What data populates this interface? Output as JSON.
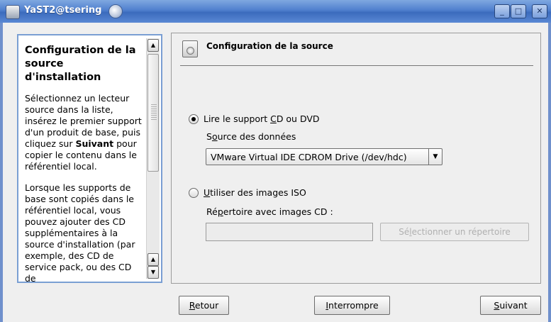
{
  "window": {
    "title": "YaST2@tsering",
    "controls": {
      "minimize": "minimize-icon",
      "maximize": "maximize-icon",
      "close": "close-icon"
    }
  },
  "help": {
    "title": "Configuration de la source d'installation",
    "paragraph1_before": "Sélectionnez un lecteur source dans la liste, insérez le premier support d'un produit de base, puis cliquez sur",
    "paragraph1_bold": "Suivant",
    "paragraph1_after": "pour copier le contenu dans le référentiel local.",
    "paragraph2": "Lorsque les supports de base sont copiés dans le référentiel local, vous pouvez ajouter des CD supplémentaires à la source d'installation (par exemple, des CD de service pack, ou des CD de"
  },
  "panel": {
    "title": "Configuration de la source",
    "option_cd": {
      "pre": "Lire le support ",
      "accel": "C",
      "post": "D ou DVD",
      "selected": true
    },
    "data_source_label": {
      "pre": "S",
      "accel": "o",
      "post": "urce des données"
    },
    "combo_value": "VMware Virtual IDE CDROM Drive (/dev/hdc)",
    "option_iso": {
      "accel": "U",
      "post": "tiliser des images ISO",
      "selected": false
    },
    "iso_dir_label": {
      "pre": "Ré",
      "accel": "p",
      "post": "ertoire avec images CD :"
    },
    "iso_dir_value": "",
    "select_dir_button": {
      "pre": "Sé",
      "accel": "l",
      "post": "ectionner un répertoire"
    }
  },
  "buttons": {
    "back": {
      "accel": "R",
      "post": "etour"
    },
    "abort": {
      "accel": "I",
      "post": "nterrompre"
    },
    "next": {
      "accel": "S",
      "post": "uivant"
    }
  }
}
